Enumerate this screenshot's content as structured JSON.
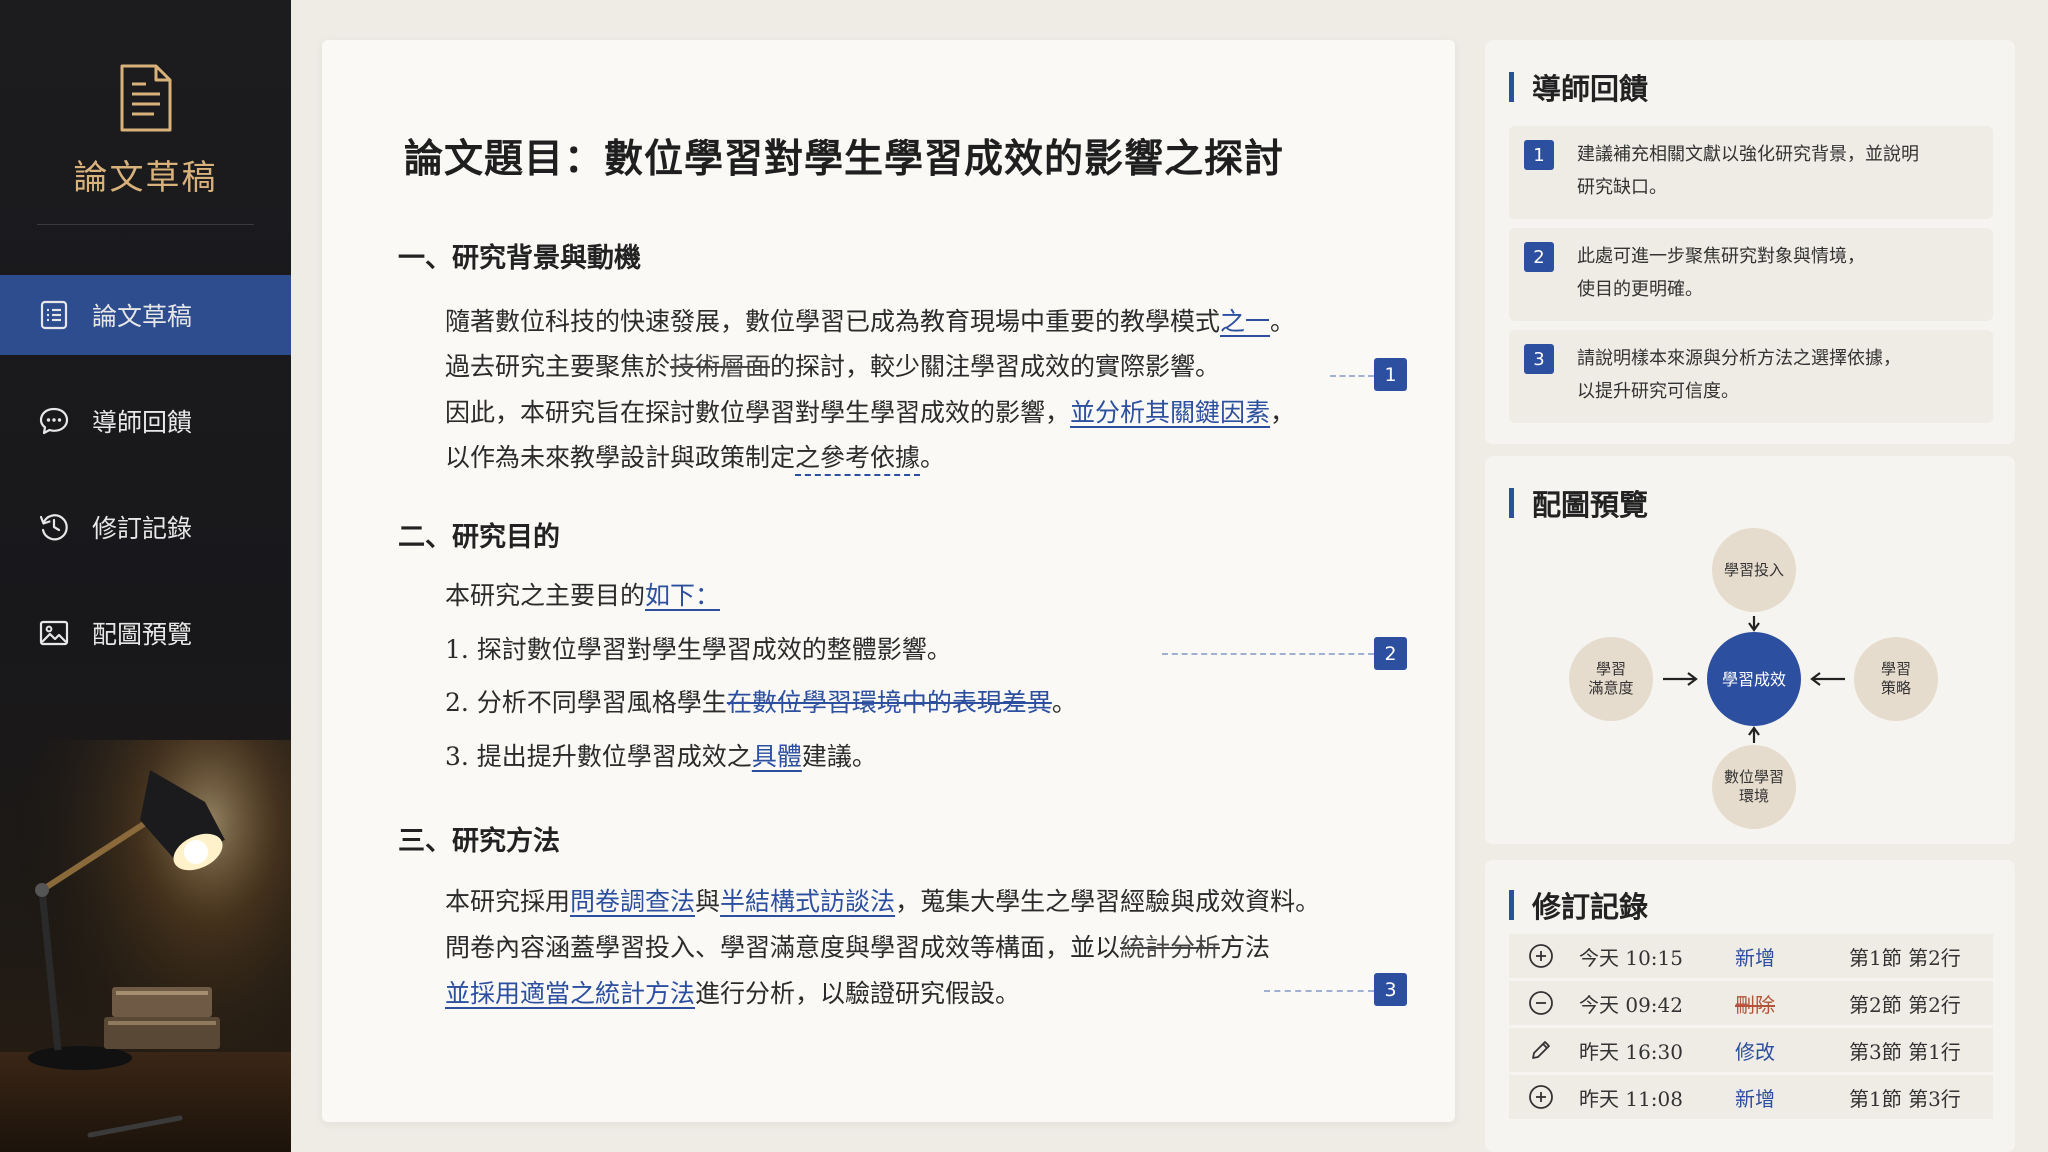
{
  "sidebar": {
    "brand_title": "論文草稿",
    "items": [
      {
        "label": "論文草稿",
        "icon": "document-icon",
        "active": true
      },
      {
        "label": "導師回饋",
        "icon": "chat-bubble-icon",
        "active": false
      },
      {
        "label": "修訂記錄",
        "icon": "history-icon",
        "active": false
      },
      {
        "label": "配圖預覽",
        "icon": "image-icon",
        "active": false
      }
    ]
  },
  "paper": {
    "title": "論文題目：數位學習對學生學習成效的影響之探討",
    "sections": [
      {
        "heading": "一、研究背景與動機",
        "lines": [
          {
            "a": "隨著數位科技的快速發展，數位學習已成為教育現場中重要的教學模式",
            "ins": "之一",
            "b": "。"
          },
          {
            "a": "過去研究主要聚焦於",
            "del": "技術層面",
            "b": "的探討，較少關注學習成效的實際影響。"
          },
          {
            "a": "因此，本研究旨在探討數位學習對學生學習成效的影響，",
            "ins": "並分析其關鍵因素",
            "b": "，"
          },
          {
            "a": "以作為未來教學設計與政策制定",
            "dash": "之參考依據",
            "b": "。"
          }
        ]
      },
      {
        "heading": "二、研究目的",
        "lines": [
          {
            "a": "本研究之主要目的",
            "ins": "如下：",
            "b": ""
          },
          {
            "a": "1. 探討數位學習對學生學習成效的整體影響。",
            "b": ""
          },
          {
            "a": "2. 分析不同學習風格學生",
            "del": "在數位學習環境中的表現差異",
            "b": "。"
          },
          {
            "a": "3. 提出提升數位學習成效之",
            "ins": "具體",
            "b": "建議。"
          }
        ]
      },
      {
        "heading": "三、研究方法",
        "lines": [
          {
            "a": "本研究採用",
            "ins": "問卷調查法",
            "mid": "與",
            "ins2": "半結構式訪談法",
            "b": "，蒐集大學生之學習經驗與成效資料。"
          },
          {
            "a": "問卷內容涵蓋學習投入、學習滿意度與學習成效等構面，並以",
            "del": "統計分析",
            "b": "方法"
          },
          {
            "ins": "並採用適當之統計方法",
            "b": "進行分析，以驗證研究假設。"
          }
        ]
      }
    ],
    "markers": [
      "1",
      "2",
      "3"
    ]
  },
  "feedback": {
    "title": "導師回饋",
    "items": [
      {
        "num": "1",
        "line1": "建議補充相關文獻以強化研究背景，並說明",
        "line2": "研究缺口。"
      },
      {
        "num": "2",
        "line1": "此處可進一步聚焦研究對象與情境，",
        "line2": "使目的更明確。"
      },
      {
        "num": "3",
        "line1": "請說明樣本來源與分析方法之選擇依據，",
        "line2": "以提升研究可信度。"
      }
    ]
  },
  "figure": {
    "title": "配圖預覽",
    "center": "學習成效",
    "top": "學習投入",
    "left1": "學習",
    "left2": "滿意度",
    "right1": "學習",
    "right2": "策略",
    "bottom1": "數位學習",
    "bottom2": "環境"
  },
  "revisions": {
    "title": "修訂記錄",
    "rows": [
      {
        "icon": "plus-circle-icon",
        "time": "今天 10:15",
        "type": "新增",
        "kind": "add",
        "loc": "第1節 第2行"
      },
      {
        "icon": "minus-circle-icon",
        "time": "今天 09:42",
        "type": "刪除",
        "kind": "del",
        "loc": "第2節 第2行"
      },
      {
        "icon": "pencil-icon",
        "time": "昨天 16:30",
        "type": "修改",
        "kind": "mod",
        "loc": "第3節 第1行"
      },
      {
        "icon": "plus-circle-icon",
        "time": "昨天 11:08",
        "type": "新增",
        "kind": "add",
        "loc": "第1節 第3行"
      }
    ]
  },
  "colors": {
    "accent": "#2c4f9f",
    "brand_gold": "#d8b27a",
    "delete_red": "#b0553a"
  }
}
